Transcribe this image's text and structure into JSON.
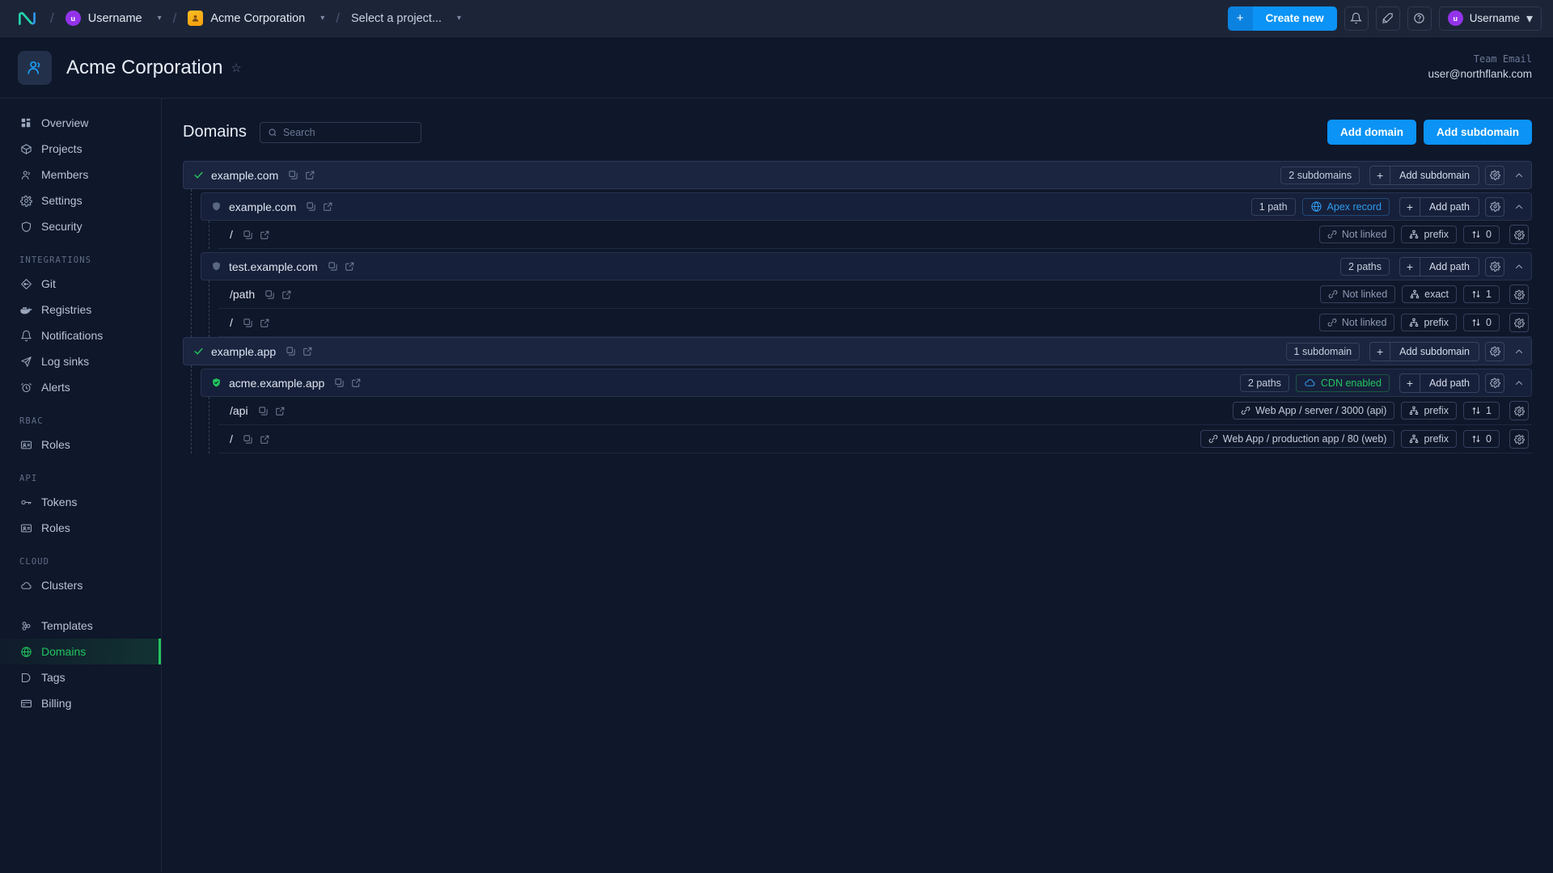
{
  "topbar": {
    "logo": "northflank-logo",
    "user_chip": {
      "avatar_letter": "u",
      "label": "Username"
    },
    "org_chip": {
      "label": "Acme Corporation"
    },
    "project_select": {
      "label": "Select a project..."
    },
    "create_new": "Create new",
    "icons": [
      "bell-icon",
      "rocket-icon",
      "help-icon"
    ],
    "account": {
      "avatar_letter": "u",
      "label": "Username"
    }
  },
  "pagehead": {
    "title": "Acme Corporation",
    "star": "☆",
    "meta_label": "Team Email",
    "meta_value": "user@northflank.com"
  },
  "sidebar": {
    "items": [
      {
        "label": "Overview",
        "icon": "grid-icon",
        "active": false
      },
      {
        "label": "Projects",
        "icon": "box-icon",
        "active": false
      },
      {
        "label": "Members",
        "icon": "users-icon",
        "active": false
      },
      {
        "label": "Settings",
        "icon": "gear-icon",
        "active": false
      },
      {
        "label": "Security",
        "icon": "shield-icon",
        "active": false
      }
    ],
    "groups": [
      {
        "title": "INTEGRATIONS",
        "items": [
          {
            "label": "Git",
            "icon": "git-icon",
            "active": false
          },
          {
            "label": "Registries",
            "icon": "docker-icon",
            "active": false
          },
          {
            "label": "Notifications",
            "icon": "bell-icon",
            "active": false
          },
          {
            "label": "Log sinks",
            "icon": "send-icon",
            "active": false
          },
          {
            "label": "Alerts",
            "icon": "alarm-icon",
            "active": false
          }
        ]
      },
      {
        "title": "RBAC",
        "items": [
          {
            "label": "Roles",
            "icon": "id-card-icon",
            "active": false
          }
        ]
      },
      {
        "title": "API",
        "items": [
          {
            "label": "Tokens",
            "icon": "key-icon",
            "active": false
          },
          {
            "label": "Roles",
            "icon": "id-card-icon",
            "active": false
          }
        ]
      },
      {
        "title": "CLOUD",
        "items": [
          {
            "label": "Clusters",
            "icon": "cloud-icon",
            "active": false
          }
        ]
      }
    ],
    "bottom_items": [
      {
        "label": "Templates",
        "icon": "templates-icon",
        "active": false
      },
      {
        "label": "Domains",
        "icon": "globe-icon",
        "active": true
      },
      {
        "label": "Tags",
        "icon": "tag-icon",
        "active": false
      },
      {
        "label": "Billing",
        "icon": "card-icon",
        "active": false
      }
    ],
    "active_color": "#22c55e"
  },
  "main": {
    "title": "Domains",
    "search_placeholder": "Search",
    "search_value": "",
    "add_domain": "Add domain",
    "add_subdomain": "Add subdomain"
  },
  "labels": {
    "add_subdomain": "Add subdomain",
    "add_path": "Add path",
    "plus": "+",
    "collapse": "⌃"
  },
  "domains": [
    {
      "name": "example.com",
      "status_icon": "check-icon",
      "status_color": "#22c55e",
      "badge": "2 subdomains",
      "action_label": "Add subdomain",
      "subdomains": [
        {
          "name": "example.com",
          "status_icon": "shield-icon",
          "status_color": "#5a6782",
          "badges": [
            {
              "text": "1 path",
              "icon": null
            },
            {
              "text": "Apex record",
              "icon": "globe-icon",
              "icon_color": "#2e9bf0"
            }
          ],
          "action_label": "Add path",
          "paths": [
            {
              "path": "/",
              "link_badge": "Not linked",
              "link_icon": "link-icon",
              "linked": false,
              "match_badge": "prefix",
              "match_icon": "sitemap-icon",
              "priority_badge": "0",
              "priority_icon": "sort-icon"
            }
          ]
        },
        {
          "name": "test.example.com",
          "status_icon": "shield-icon",
          "status_color": "#5a6782",
          "badges": [
            {
              "text": "2 paths",
              "icon": null
            }
          ],
          "action_label": "Add path",
          "paths": [
            {
              "path": "/path",
              "link_badge": "Not linked",
              "link_icon": "link-icon",
              "linked": false,
              "match_badge": "exact",
              "match_icon": "sitemap-icon",
              "priority_badge": "1",
              "priority_icon": "sort-icon"
            },
            {
              "path": "/",
              "link_badge": "Not linked",
              "link_icon": "link-icon",
              "linked": false,
              "match_badge": "prefix",
              "match_icon": "sitemap-icon",
              "priority_badge": "0",
              "priority_icon": "sort-icon"
            }
          ]
        }
      ]
    },
    {
      "name": "example.app",
      "status_icon": "check-icon",
      "status_color": "#22c55e",
      "badge": "1 subdomain",
      "action_label": "Add subdomain",
      "subdomains": [
        {
          "name": "acme.example.app",
          "status_icon": "shield-check-icon",
          "status_color": "#22c55e",
          "badges": [
            {
              "text": "2 paths",
              "icon": null
            },
            {
              "text": "CDN enabled",
              "icon": "cloud-icon",
              "icon_color": "#22c55e"
            }
          ],
          "action_label": "Add path",
          "paths": [
            {
              "path": "/api",
              "link_badge": "Web App / server / 3000 (api)",
              "link_icon": "link-icon",
              "linked": true,
              "match_badge": "prefix",
              "match_icon": "sitemap-icon",
              "priority_badge": "1",
              "priority_icon": "sort-icon"
            },
            {
              "path": "/",
              "link_badge": "Web App / production app / 80 (web)",
              "link_icon": "link-icon",
              "linked": true,
              "match_badge": "prefix",
              "match_icon": "sitemap-icon",
              "priority_badge": "0",
              "priority_icon": "sort-icon"
            }
          ]
        }
      ]
    }
  ]
}
